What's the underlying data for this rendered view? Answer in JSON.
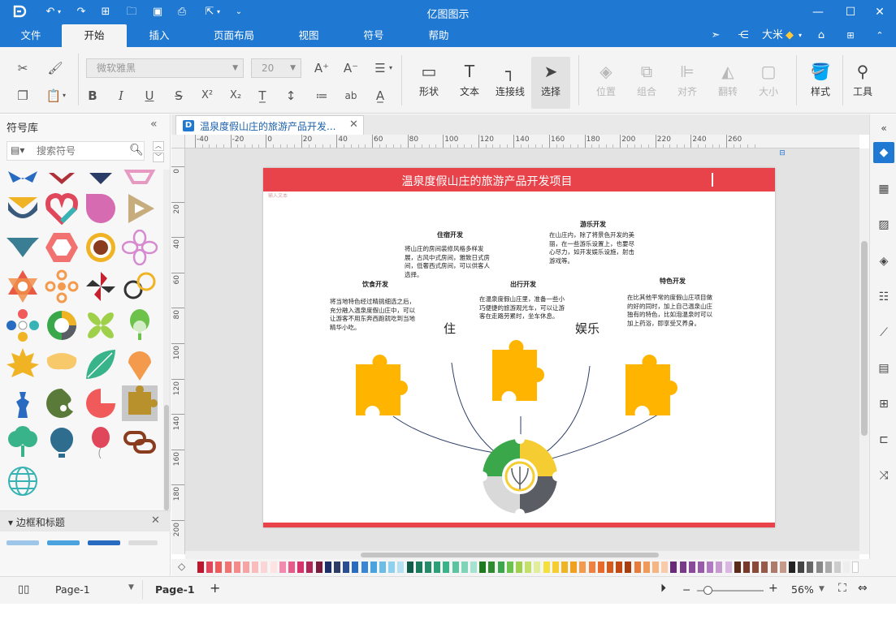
{
  "app": {
    "title": "亿图图示",
    "quick_access": [
      "logo-icon",
      "undo-icon",
      "redo-icon",
      "new-icon",
      "open-icon",
      "save-icon",
      "print-icon",
      "export-icon",
      "more-icon"
    ]
  },
  "menu": {
    "tabs": [
      "文件",
      "开始",
      "插入",
      "页面布局",
      "视图",
      "符号",
      "帮助"
    ],
    "active": "开始",
    "user": "大米"
  },
  "ribbon": {
    "font_name": "微软雅黑",
    "font_size": "20",
    "big_buttons": [
      {
        "label": "形状",
        "enabled": true
      },
      {
        "label": "文本",
        "enabled": true
      },
      {
        "label": "连接线",
        "enabled": true
      },
      {
        "label": "选择",
        "enabled": true
      },
      {
        "label": "位置",
        "enabled": false
      },
      {
        "label": "组合",
        "enabled": false
      },
      {
        "label": "对齐",
        "enabled": false
      },
      {
        "label": "翻转",
        "enabled": false
      },
      {
        "label": "大小",
        "enabled": false
      },
      {
        "label": "样式",
        "enabled": true
      },
      {
        "label": "工具",
        "enabled": true
      }
    ]
  },
  "symbol_panel": {
    "title": "符号库",
    "search_placeholder": "搜索符号",
    "section2_title": "边框和标题"
  },
  "document": {
    "tab_name": "温泉度假山庄的旅游产品开发...",
    "page_title": "温泉度假山庄的旅游产品开发项目",
    "tiny_caption": "输入文本",
    "sections": [
      {
        "title": "住宿开发",
        "text": "将山庄的房间装修风格多样发展，古风中式房间，雅致日式房间，低奢西式房间，可以供客人选择。"
      },
      {
        "title": "游乐开发",
        "text": "在山庄内，除了将景色开发的美丽，在一些游乐设置上，也要尽心尽力，如开发娱乐设施，射击游戏等。"
      },
      {
        "title": "饮食开发",
        "text": "将当地特色经过精挑细选之后，充分融入温泉度假山庄中，可以让游客不用东奔西跑就吃到当地精华小吃。"
      },
      {
        "title": "出行开发",
        "text": "在温泉度假山庄里，准备一些小巧便捷的旅游观光车，可以让游客在走路劳累时，坐车休息。"
      },
      {
        "title": "特色开发",
        "text": "在比其他平常的度假山庄项目做的好的同时，加上自己温泉山庄独有的特色，比如泡温泉时可以加上药浴，即享受又养身。"
      }
    ],
    "words": [
      "住",
      "娱乐"
    ]
  },
  "rulers": {
    "h_ticks": [
      "-40",
      "-20",
      "0",
      "20",
      "40",
      "60",
      "80",
      "100",
      "120",
      "140",
      "160",
      "180",
      "200",
      "220",
      "240",
      "260"
    ],
    "v_ticks": [
      "0",
      "20",
      "40",
      "60",
      "80",
      "100",
      "120",
      "140",
      "160",
      "180",
      "200"
    ]
  },
  "status": {
    "page_dropdown": "Page-1",
    "page_tab": "Page-1",
    "zoom": "56%"
  },
  "colors": {
    "accent": "#1f78d1",
    "banner": "#e8434a",
    "puzzle": "#ffb400",
    "wheel": [
      "#3aa84a",
      "#f5cd33",
      "#5a5d64",
      "#d9d9d9"
    ]
  }
}
